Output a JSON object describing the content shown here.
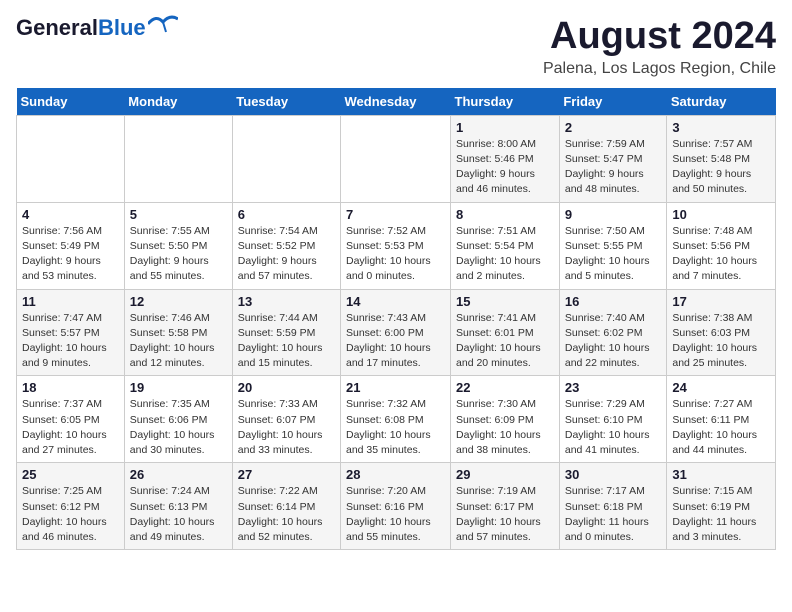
{
  "header": {
    "logo_line1": "General",
    "logo_line2": "Blue",
    "month": "August 2024",
    "location": "Palena, Los Lagos Region, Chile"
  },
  "days_of_week": [
    "Sunday",
    "Monday",
    "Tuesday",
    "Wednesday",
    "Thursday",
    "Friday",
    "Saturday"
  ],
  "weeks": [
    [
      {
        "day": "",
        "info": ""
      },
      {
        "day": "",
        "info": ""
      },
      {
        "day": "",
        "info": ""
      },
      {
        "day": "",
        "info": ""
      },
      {
        "day": "1",
        "info": "Sunrise: 8:00 AM\nSunset: 5:46 PM\nDaylight: 9 hours\nand 46 minutes."
      },
      {
        "day": "2",
        "info": "Sunrise: 7:59 AM\nSunset: 5:47 PM\nDaylight: 9 hours\nand 48 minutes."
      },
      {
        "day": "3",
        "info": "Sunrise: 7:57 AM\nSunset: 5:48 PM\nDaylight: 9 hours\nand 50 minutes."
      }
    ],
    [
      {
        "day": "4",
        "info": "Sunrise: 7:56 AM\nSunset: 5:49 PM\nDaylight: 9 hours\nand 53 minutes."
      },
      {
        "day": "5",
        "info": "Sunrise: 7:55 AM\nSunset: 5:50 PM\nDaylight: 9 hours\nand 55 minutes."
      },
      {
        "day": "6",
        "info": "Sunrise: 7:54 AM\nSunset: 5:52 PM\nDaylight: 9 hours\nand 57 minutes."
      },
      {
        "day": "7",
        "info": "Sunrise: 7:52 AM\nSunset: 5:53 PM\nDaylight: 10 hours\nand 0 minutes."
      },
      {
        "day": "8",
        "info": "Sunrise: 7:51 AM\nSunset: 5:54 PM\nDaylight: 10 hours\nand 2 minutes."
      },
      {
        "day": "9",
        "info": "Sunrise: 7:50 AM\nSunset: 5:55 PM\nDaylight: 10 hours\nand 5 minutes."
      },
      {
        "day": "10",
        "info": "Sunrise: 7:48 AM\nSunset: 5:56 PM\nDaylight: 10 hours\nand 7 minutes."
      }
    ],
    [
      {
        "day": "11",
        "info": "Sunrise: 7:47 AM\nSunset: 5:57 PM\nDaylight: 10 hours\nand 9 minutes."
      },
      {
        "day": "12",
        "info": "Sunrise: 7:46 AM\nSunset: 5:58 PM\nDaylight: 10 hours\nand 12 minutes."
      },
      {
        "day": "13",
        "info": "Sunrise: 7:44 AM\nSunset: 5:59 PM\nDaylight: 10 hours\nand 15 minutes."
      },
      {
        "day": "14",
        "info": "Sunrise: 7:43 AM\nSunset: 6:00 PM\nDaylight: 10 hours\nand 17 minutes."
      },
      {
        "day": "15",
        "info": "Sunrise: 7:41 AM\nSunset: 6:01 PM\nDaylight: 10 hours\nand 20 minutes."
      },
      {
        "day": "16",
        "info": "Sunrise: 7:40 AM\nSunset: 6:02 PM\nDaylight: 10 hours\nand 22 minutes."
      },
      {
        "day": "17",
        "info": "Sunrise: 7:38 AM\nSunset: 6:03 PM\nDaylight: 10 hours\nand 25 minutes."
      }
    ],
    [
      {
        "day": "18",
        "info": "Sunrise: 7:37 AM\nSunset: 6:05 PM\nDaylight: 10 hours\nand 27 minutes."
      },
      {
        "day": "19",
        "info": "Sunrise: 7:35 AM\nSunset: 6:06 PM\nDaylight: 10 hours\nand 30 minutes."
      },
      {
        "day": "20",
        "info": "Sunrise: 7:33 AM\nSunset: 6:07 PM\nDaylight: 10 hours\nand 33 minutes."
      },
      {
        "day": "21",
        "info": "Sunrise: 7:32 AM\nSunset: 6:08 PM\nDaylight: 10 hours\nand 35 minutes."
      },
      {
        "day": "22",
        "info": "Sunrise: 7:30 AM\nSunset: 6:09 PM\nDaylight: 10 hours\nand 38 minutes."
      },
      {
        "day": "23",
        "info": "Sunrise: 7:29 AM\nSunset: 6:10 PM\nDaylight: 10 hours\nand 41 minutes."
      },
      {
        "day": "24",
        "info": "Sunrise: 7:27 AM\nSunset: 6:11 PM\nDaylight: 10 hours\nand 44 minutes."
      }
    ],
    [
      {
        "day": "25",
        "info": "Sunrise: 7:25 AM\nSunset: 6:12 PM\nDaylight: 10 hours\nand 46 minutes."
      },
      {
        "day": "26",
        "info": "Sunrise: 7:24 AM\nSunset: 6:13 PM\nDaylight: 10 hours\nand 49 minutes."
      },
      {
        "day": "27",
        "info": "Sunrise: 7:22 AM\nSunset: 6:14 PM\nDaylight: 10 hours\nand 52 minutes."
      },
      {
        "day": "28",
        "info": "Sunrise: 7:20 AM\nSunset: 6:16 PM\nDaylight: 10 hours\nand 55 minutes."
      },
      {
        "day": "29",
        "info": "Sunrise: 7:19 AM\nSunset: 6:17 PM\nDaylight: 10 hours\nand 57 minutes."
      },
      {
        "day": "30",
        "info": "Sunrise: 7:17 AM\nSunset: 6:18 PM\nDaylight: 11 hours\nand 0 minutes."
      },
      {
        "day": "31",
        "info": "Sunrise: 7:15 AM\nSunset: 6:19 PM\nDaylight: 11 hours\nand 3 minutes."
      }
    ]
  ]
}
